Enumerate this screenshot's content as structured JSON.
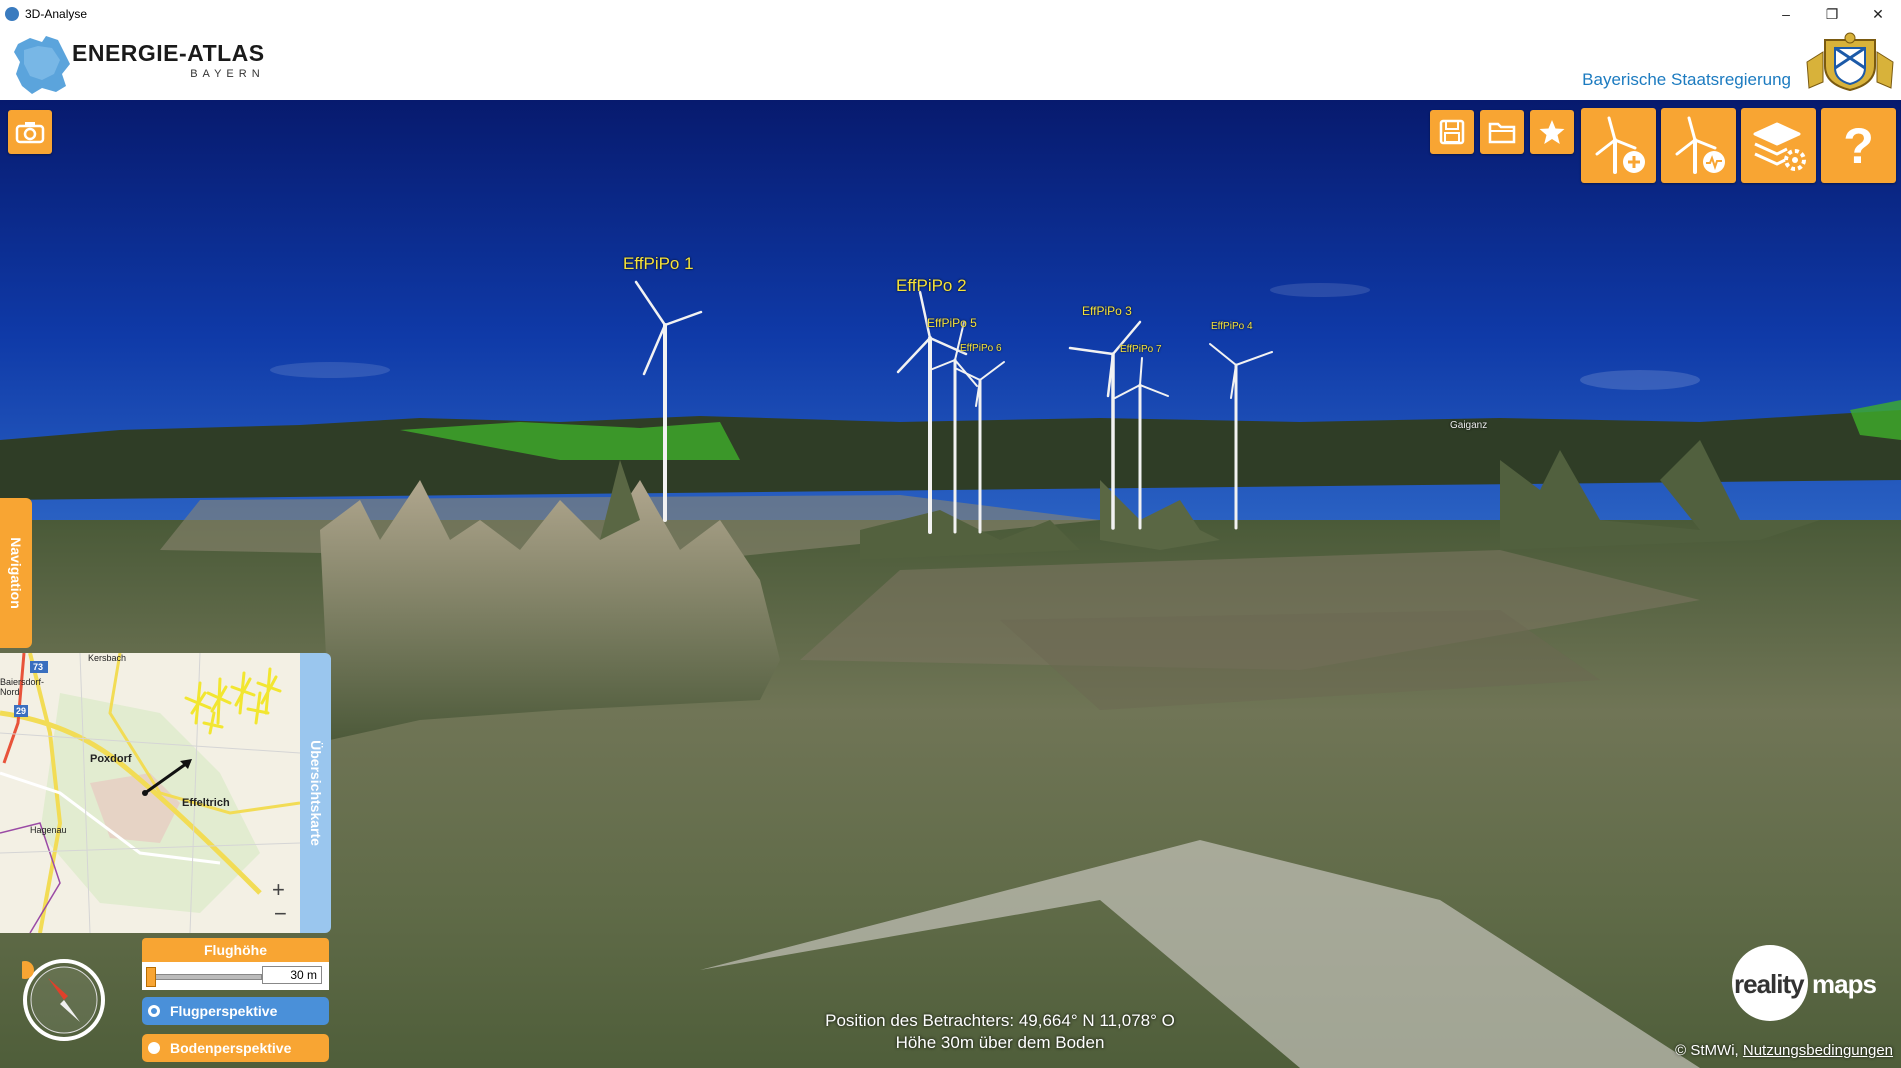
{
  "window": {
    "title": "3D-Analyse",
    "minimize_glyph": "–",
    "restore_glyph": "❐",
    "close_glyph": "✕"
  },
  "header": {
    "logo_title": "ENERGIE-ATLAS",
    "logo_subtitle": "BAYERN",
    "government": "Bayerische Staatsregierung"
  },
  "toolbar": {
    "camera_icon": "camera-icon",
    "buttons": [
      {
        "name": "save",
        "icon": "save-icon"
      },
      {
        "name": "open",
        "icon": "folder-icon"
      },
      {
        "name": "favorite",
        "icon": "star-icon"
      },
      {
        "name": "add-turbine",
        "icon": "wind-turbine-add-icon"
      },
      {
        "name": "turbine-analysis",
        "icon": "wind-turbine-signal-icon"
      },
      {
        "name": "layer-settings",
        "icon": "layers-gear-icon"
      },
      {
        "name": "help",
        "icon": "help-icon",
        "glyph": "?"
      }
    ],
    "color": "#f8a533"
  },
  "scene": {
    "turbines": [
      {
        "label": "EffPiPo 1"
      },
      {
        "label": "EffPiPo 2"
      },
      {
        "label": "EffPiPo 5"
      },
      {
        "label": "EffPiPo 6"
      },
      {
        "label": "EffPiPo 3"
      },
      {
        "label": "EffPiPo 7"
      },
      {
        "label": "EffPiPo 4"
      }
    ],
    "places": [
      "Gaiganz",
      "Effeltrich"
    ],
    "sky_color": "#0d2a8c",
    "ground_color": "#5f6e45"
  },
  "navigation_tab": "Navigation",
  "overview_map": {
    "tab_label": "Übersichtskarte",
    "labels": [
      "Kersbach",
      "Baiersdorf-Nord",
      "Poxdorf",
      "Effeltrich",
      "Hagenau"
    ],
    "road_numbers": [
      "73",
      "29"
    ],
    "zoom_in": "+",
    "zoom_out": "−"
  },
  "flight_controls": {
    "height_label": "Flughöhe",
    "height_value": "30 m",
    "height_fraction": 0.0,
    "perspectives": [
      {
        "label": "Flugperspektive",
        "selected": true,
        "color": "#4a90d9"
      },
      {
        "label": "Bodenperspektive",
        "selected": false,
        "color": "#f8a533"
      }
    ]
  },
  "viewer_info": {
    "position": "Position des Betrachters: 49,664° N 11,078° O",
    "height": "Höhe 30m über dem Boden"
  },
  "branding": {
    "reality_prefix": "reality",
    "reality_suffix": "maps"
  },
  "footer": {
    "copyright": "© StMWi,",
    "terms_link": "Nutzungsbedingungen"
  }
}
